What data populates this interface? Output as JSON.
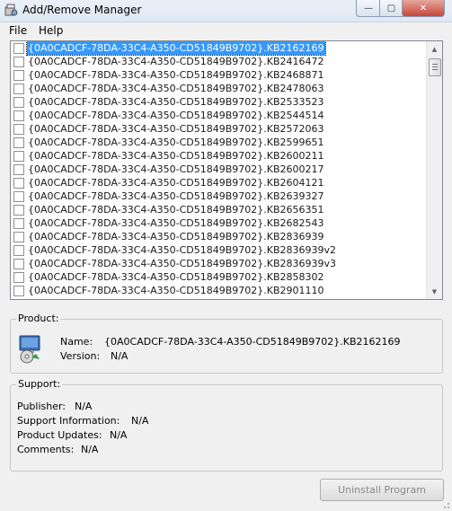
{
  "window": {
    "title": "Add/Remove Manager",
    "controls": {
      "minimize": "—",
      "maximize": "▢",
      "close": "✕"
    }
  },
  "menu": [
    "File",
    "Help"
  ],
  "list": {
    "items": [
      "{0A0CADCF-78DA-33C4-A350-CD51849B9702}.KB2162169",
      "{0A0CADCF-78DA-33C4-A350-CD51849B9702}.KB2416472",
      "{0A0CADCF-78DA-33C4-A350-CD51849B9702}.KB2468871",
      "{0A0CADCF-78DA-33C4-A350-CD51849B9702}.KB2478063",
      "{0A0CADCF-78DA-33C4-A350-CD51849B9702}.KB2533523",
      "{0A0CADCF-78DA-33C4-A350-CD51849B9702}.KB2544514",
      "{0A0CADCF-78DA-33C4-A350-CD51849B9702}.KB2572063",
      "{0A0CADCF-78DA-33C4-A350-CD51849B9702}.KB2599651",
      "{0A0CADCF-78DA-33C4-A350-CD51849B9702}.KB2600211",
      "{0A0CADCF-78DA-33C4-A350-CD51849B9702}.KB2600217",
      "{0A0CADCF-78DA-33C4-A350-CD51849B9702}.KB2604121",
      "{0A0CADCF-78DA-33C4-A350-CD51849B9702}.KB2639327",
      "{0A0CADCF-78DA-33C4-A350-CD51849B9702}.KB2656351",
      "{0A0CADCF-78DA-33C4-A350-CD51849B9702}.KB2682543",
      "{0A0CADCF-78DA-33C4-A350-CD51849B9702}.KB2836939",
      "{0A0CADCF-78DA-33C4-A350-CD51849B9702}.KB2836939v2",
      "{0A0CADCF-78DA-33C4-A350-CD51849B9702}.KB2836939v3",
      "{0A0CADCF-78DA-33C4-A350-CD51849B9702}.KB2858302",
      "{0A0CADCF-78DA-33C4-A350-CD51849B9702}.KB2901110"
    ],
    "selected_index": 0
  },
  "product": {
    "group_title": "Product:",
    "name_label": "Name:",
    "name_value": "{0A0CADCF-78DA-33C4-A350-CD51849B9702}.KB2162169",
    "version_label": "Version:",
    "version_value": "N/A"
  },
  "support": {
    "group_title": "Support:",
    "publisher_label": "Publisher:",
    "publisher_value": "N/A",
    "support_info_label": "Support Information:",
    "support_info_value": "N/A",
    "product_updates_label": "Product Updates:",
    "product_updates_value": "N/A",
    "comments_label": "Comments:",
    "comments_value": "N/A"
  },
  "buttons": {
    "uninstall": "Uninstall Program"
  },
  "colors": {
    "selection": "#3399ff",
    "close": "#c7453a"
  }
}
